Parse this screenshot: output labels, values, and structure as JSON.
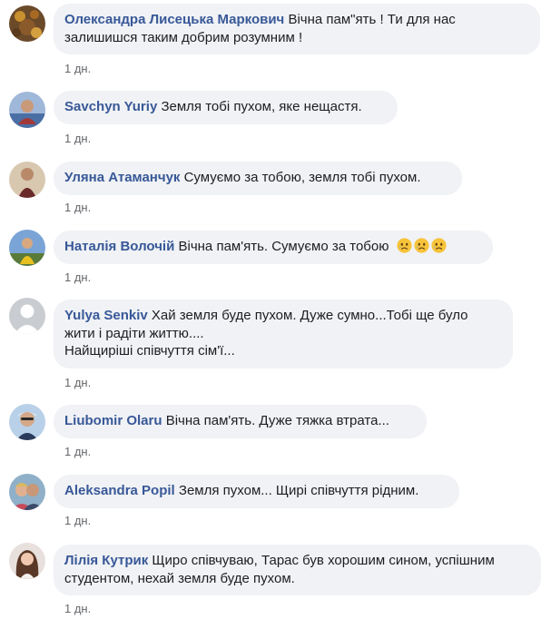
{
  "comments": [
    {
      "author": "Олександра Лисецька Маркович",
      "text": "Вічна пам\"ять ! Ти для нас залишишся таким добрим розумним !",
      "time": "1 дн."
    },
    {
      "author": "Savchyn Yuriy",
      "text": "Земля тобі пухом, яке нещастя.",
      "time": "1 дн."
    },
    {
      "author": "Уляна Атаманчук",
      "text": "Сумуємо за тобою, земля тобі пухом.",
      "time": "1 дн."
    },
    {
      "author": "Наталія Волочій",
      "text": "Вічна пам'ять. Сумуємо за тобою",
      "emojis": [
        "sad-face-emoji",
        "sad-face-emoji",
        "sad-face-emoji"
      ],
      "time": "1 дн."
    },
    {
      "author": "Yulya Senkiv",
      "text": "Хай земля буде пухом. Дуже сумно...Тобі ще було жити і радіти життю....",
      "text2": "Найщиріші співчуття сім'ї...",
      "time": "1 дн."
    },
    {
      "author": "Liubomir Olaru",
      "text": "Вічна пам'ять. Дуже тяжка втрата...",
      "time": "1 дн."
    },
    {
      "author": "Aleksandra Popil",
      "text": "Земля пухом... Щирі співчуття рідним.",
      "time": "1 дн."
    },
    {
      "author": "Лілія Кутрик",
      "text": "Щиро співчуваю, Тарас був хорошим сином, успішним студентом, нехай земля буде пухом.",
      "time": "1 дн."
    }
  ],
  "colors": {
    "author": "#385898",
    "bubble": "#f0f2f5",
    "meta": "#65676b"
  }
}
